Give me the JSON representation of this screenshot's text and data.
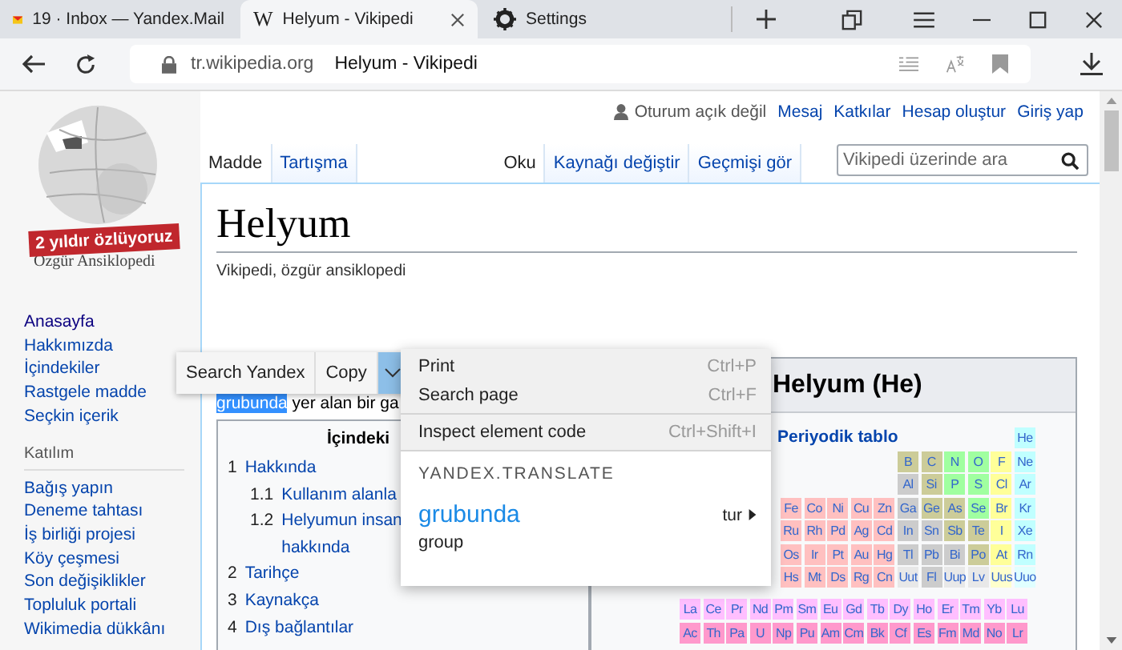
{
  "browser_tabs": [
    {
      "title": "19 · Inbox — Yandex.Mail",
      "kind": "mail",
      "selected": false
    },
    {
      "title": "Helyum - Vikipedi",
      "kind": "wiki",
      "icon_text": "W",
      "selected": true
    },
    {
      "title": "Settings",
      "kind": "settings",
      "selected": false
    }
  ],
  "address_bar": {
    "domain": "tr.wikipedia.org",
    "page_title": "Helyum - Vikipedi"
  },
  "logo": {
    "badge": "2 yıldır özlüyoruz",
    "tagline": "Özgür Ansiklopedi"
  },
  "sidebar": {
    "nav": [
      {
        "label": "Anasayfa",
        "visited": true
      },
      {
        "label": "Hakkımızda",
        "visited": false
      },
      {
        "label": "İçindekiler",
        "visited": false
      },
      {
        "label": "Rastgele madde",
        "visited": false
      },
      {
        "label": "Seçkin içerik",
        "visited": false
      }
    ],
    "section_title": "Katılım",
    "section_items": [
      "Bağış yapın",
      "Deneme tahtası",
      "İş birliği projesi",
      "Köy çeşmesi",
      "Son değişiklikler",
      "Topluluk portali",
      "Wikimedia dükkânı"
    ]
  },
  "user_links": {
    "status": "Oturum açık değil",
    "links": [
      "Mesaj",
      "Katkılar",
      "Hesap oluştur",
      "Giriş yap"
    ]
  },
  "page_tabs_left": [
    {
      "label": "Madde",
      "selected": true
    },
    {
      "label": "Tartışma",
      "selected": false
    }
  ],
  "page_tabs_right": [
    {
      "label": "Oku",
      "selected": true
    },
    {
      "label": "Kaynağı değiştir",
      "selected": false
    },
    {
      "label": "Geçmişi gör",
      "selected": false
    }
  ],
  "search": {
    "placeholder": "Vikipedi üzerinde ara"
  },
  "article": {
    "title": "Helyum",
    "tagline": "Vikipedi, özgür ansiklopedi",
    "selected_word": "grubunda",
    "text_after": "yer alan bir ga"
  },
  "toc": {
    "title": "İçindeki",
    "items": [
      {
        "number": "1",
        "lines": [
          "Hakkında"
        ],
        "children": [
          {
            "number": "1.1",
            "lines": [
              "Kullanım alanla"
            ]
          },
          {
            "number": "1.2",
            "lines": [
              "Helyumun insan",
              "hakkında"
            ]
          }
        ]
      },
      {
        "number": "2",
        "lines": [
          "Tarihçe"
        ]
      },
      {
        "number": "3",
        "lines": [
          "Kaynakça"
        ]
      },
      {
        "number": "4",
        "lines": [
          "Dış bağlantılar"
        ]
      }
    ]
  },
  "infobox": {
    "title": "Helyum (He)",
    "table_link": "Periyodik tablo",
    "rows": [
      [
        null,
        null,
        null,
        null,
        null,
        null,
        null,
        null,
        null,
        null,
        {
          "symbol": "He",
          "color": "#c0ffff"
        }
      ],
      [
        null,
        null,
        null,
        null,
        null,
        {
          "symbol": "B",
          "color": "#cccc99"
        },
        {
          "symbol": "C",
          "color": "#cccc99"
        },
        {
          "symbol": "N",
          "color": "#a0ffa0"
        },
        {
          "symbol": "O",
          "color": "#a0ffa0"
        },
        {
          "symbol": "F",
          "color": "#ffff99"
        },
        {
          "symbol": "Ne",
          "color": "#c0ffff"
        }
      ],
      [
        null,
        null,
        null,
        null,
        null,
        {
          "symbol": "Al",
          "color": "#cccccc"
        },
        {
          "symbol": "Si",
          "color": "#cccc99"
        },
        {
          "symbol": "P",
          "color": "#a0ffa0"
        },
        {
          "symbol": "S",
          "color": "#a0ffa0"
        },
        {
          "symbol": "Cl",
          "color": "#ffff99"
        },
        {
          "symbol": "Ar",
          "color": "#c0ffff"
        }
      ],
      [
        {
          "symbol": "Fe",
          "color": "#ffc0c0"
        },
        {
          "symbol": "Co",
          "color": "#ffc0c0"
        },
        {
          "symbol": "Ni",
          "color": "#ffc0c0"
        },
        {
          "symbol": "Cu",
          "color": "#ffc0c0"
        },
        {
          "symbol": "Zn",
          "color": "#ffc0c0"
        },
        {
          "symbol": "Ga",
          "color": "#cccccc"
        },
        {
          "symbol": "Ge",
          "color": "#cccc99"
        },
        {
          "symbol": "As",
          "color": "#cccc99"
        },
        {
          "symbol": "Se",
          "color": "#a0ffa0"
        },
        {
          "symbol": "Br",
          "color": "#ffff99"
        },
        {
          "symbol": "Kr",
          "color": "#c0ffff"
        }
      ],
      [
        {
          "symbol": "Ru",
          "color": "#ffc0c0"
        },
        {
          "symbol": "Rh",
          "color": "#ffc0c0"
        },
        {
          "symbol": "Pd",
          "color": "#ffc0c0"
        },
        {
          "symbol": "Ag",
          "color": "#ffc0c0"
        },
        {
          "symbol": "Cd",
          "color": "#ffc0c0"
        },
        {
          "symbol": "In",
          "color": "#cccccc"
        },
        {
          "symbol": "Sn",
          "color": "#cccccc"
        },
        {
          "symbol": "Sb",
          "color": "#cccc99"
        },
        {
          "symbol": "Te",
          "color": "#cccc99"
        },
        {
          "symbol": "I",
          "color": "#ffff99"
        },
        {
          "symbol": "Xe",
          "color": "#c0ffff"
        }
      ],
      [
        {
          "symbol": "Os",
          "color": "#ffc0c0"
        },
        {
          "symbol": "Ir",
          "color": "#ffc0c0"
        },
        {
          "symbol": "Pt",
          "color": "#ffc0c0"
        },
        {
          "symbol": "Au",
          "color": "#ffc0c0"
        },
        {
          "symbol": "Hg",
          "color": "#ffc0c0"
        },
        {
          "symbol": "Tl",
          "color": "#cccccc"
        },
        {
          "symbol": "Pb",
          "color": "#cccccc"
        },
        {
          "symbol": "Bi",
          "color": "#cccccc"
        },
        {
          "symbol": "Po",
          "color": "#cccc99"
        },
        {
          "symbol": "At",
          "color": "#ffff99"
        },
        {
          "symbol": "Rn",
          "color": "#c0ffff"
        }
      ],
      [
        {
          "symbol": "Hs",
          "color": "#ffc0c0"
        },
        {
          "symbol": "Mt",
          "color": "#ffc0c0"
        },
        {
          "symbol": "Ds",
          "color": "#ffc0c0"
        },
        {
          "symbol": "Rg",
          "color": "#ffc0c0"
        },
        {
          "symbol": "Cn",
          "color": "#ffc0c0"
        },
        {
          "symbol": "Uut",
          "color": "#e8e8e8"
        },
        {
          "symbol": "Fl",
          "color": "#cccccc"
        },
        {
          "symbol": "Uup",
          "color": "#e8e8e8"
        },
        {
          "symbol": "Lv",
          "color": "#e8e8e8"
        },
        {
          "symbol": "Uus",
          "color": "#ffffcc"
        },
        {
          "symbol": "Uuo",
          "color": "#e0ffff"
        }
      ]
    ],
    "f_rows": [
      [
        {
          "symbol": "La",
          "color": "#ffbfff"
        },
        {
          "symbol": "Ce",
          "color": "#ffbfff"
        },
        {
          "symbol": "Pr",
          "color": "#ffbfff"
        },
        {
          "symbol": "Nd",
          "color": "#ffbfff"
        },
        {
          "symbol": "Pm",
          "color": "#ffbfff"
        },
        {
          "symbol": "Sm",
          "color": "#ffbfff"
        },
        {
          "symbol": "Eu",
          "color": "#ffbfff"
        },
        {
          "symbol": "Gd",
          "color": "#ffbfff"
        },
        {
          "symbol": "Tb",
          "color": "#ffbfff"
        },
        {
          "symbol": "Dy",
          "color": "#ffbfff"
        },
        {
          "symbol": "Ho",
          "color": "#ffbfff"
        },
        {
          "symbol": "Er",
          "color": "#ffbfff"
        },
        {
          "symbol": "Tm",
          "color": "#ffbfff"
        },
        {
          "symbol": "Yb",
          "color": "#ffbfff"
        },
        {
          "symbol": "Lu",
          "color": "#ffbfff"
        }
      ],
      [
        {
          "symbol": "Ac",
          "color": "#ff99cc"
        },
        {
          "symbol": "Th",
          "color": "#ff99cc"
        },
        {
          "symbol": "Pa",
          "color": "#ff99cc"
        },
        {
          "symbol": "U",
          "color": "#ff99cc"
        },
        {
          "symbol": "Np",
          "color": "#ff99cc"
        },
        {
          "symbol": "Pu",
          "color": "#ff99cc"
        },
        {
          "symbol": "Am",
          "color": "#ff99cc"
        },
        {
          "symbol": "Cm",
          "color": "#ff99cc"
        },
        {
          "symbol": "Bk",
          "color": "#ff99cc"
        },
        {
          "symbol": "Cf",
          "color": "#ff99cc"
        },
        {
          "symbol": "Es",
          "color": "#ff99cc"
        },
        {
          "symbol": "Fm",
          "color": "#ff99cc"
        },
        {
          "symbol": "Md",
          "color": "#ff99cc"
        },
        {
          "symbol": "No",
          "color": "#ff99cc"
        },
        {
          "symbol": "Lr",
          "color": "#ff99cc"
        }
      ]
    ]
  },
  "selection_toolbar": {
    "buttons": [
      "Search Yandex",
      "Copy"
    ],
    "dropdown_open": true
  },
  "context_menu": {
    "sections": [
      [
        {
          "label": "Print",
          "shortcut": "Ctrl+P"
        },
        {
          "label": "Search page",
          "shortcut": "Ctrl+F"
        }
      ],
      [
        {
          "label": "Inspect element code",
          "shortcut": "Ctrl+Shift+I"
        }
      ]
    ],
    "translate": {
      "heading": "YANDEX.TRANSLATE",
      "word": "grubunda",
      "language": "tur",
      "translation": "group"
    }
  }
}
